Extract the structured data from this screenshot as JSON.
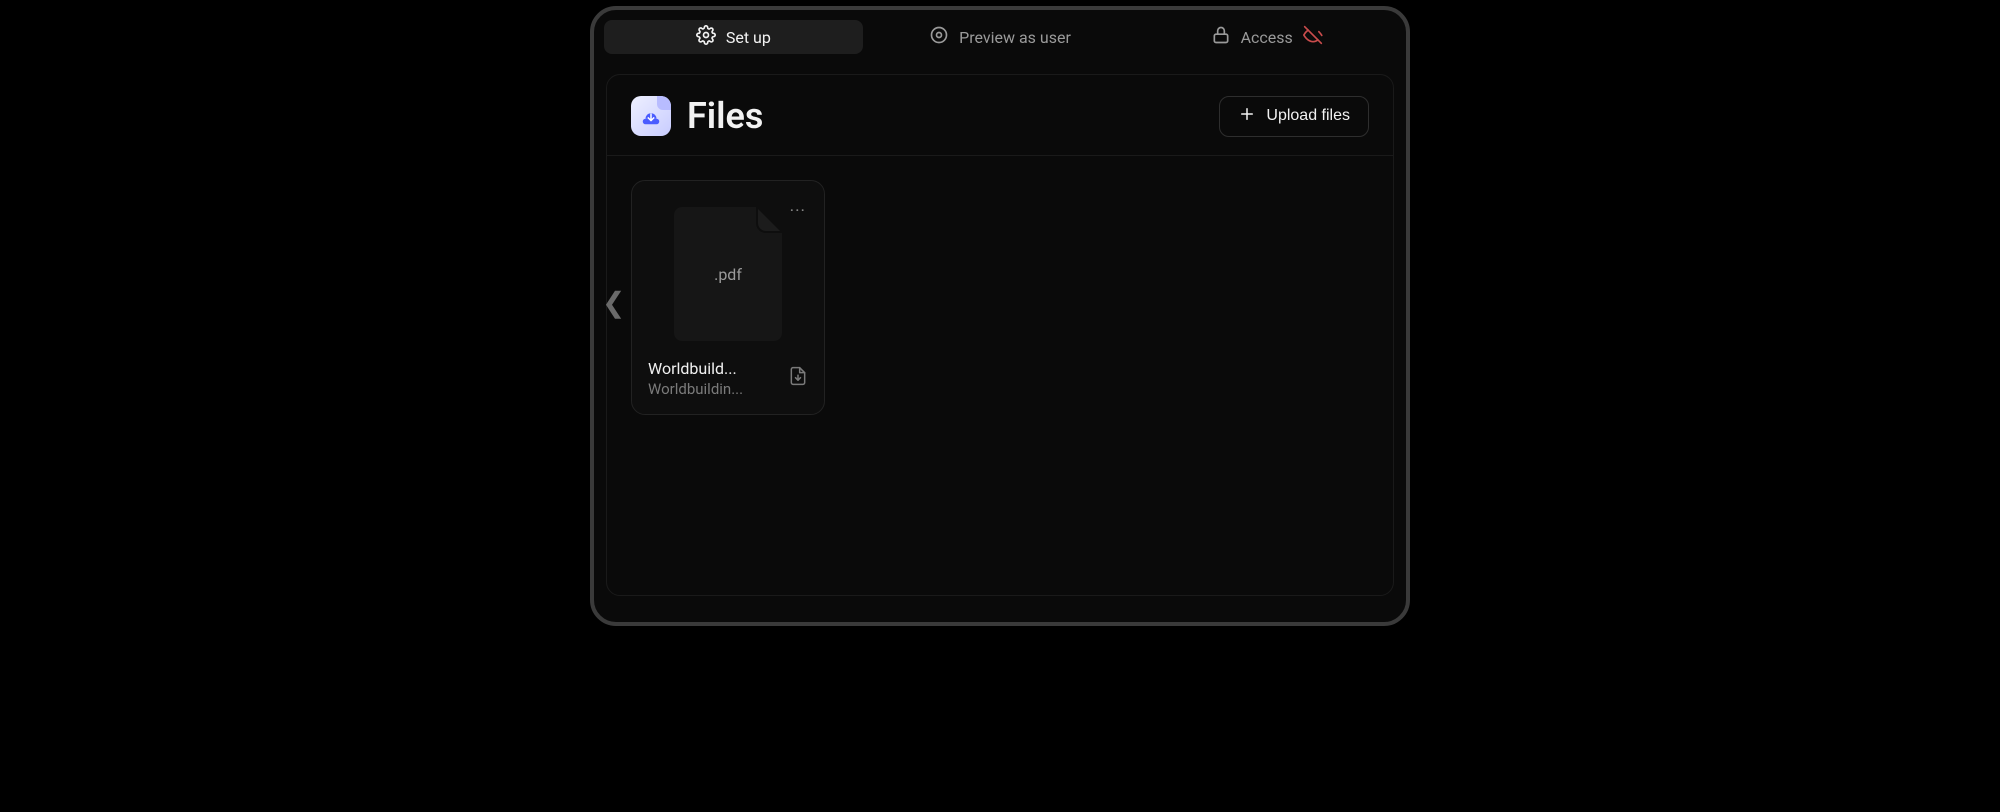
{
  "tabs": {
    "setup": "Set up",
    "preview": "Preview as user",
    "access": "Access"
  },
  "header": {
    "title": "Files",
    "upload_label": "Upload files"
  },
  "files": [
    {
      "ext": ".pdf",
      "name": "Worldbuild...",
      "subtitle": "Worldbuildin..."
    }
  ]
}
